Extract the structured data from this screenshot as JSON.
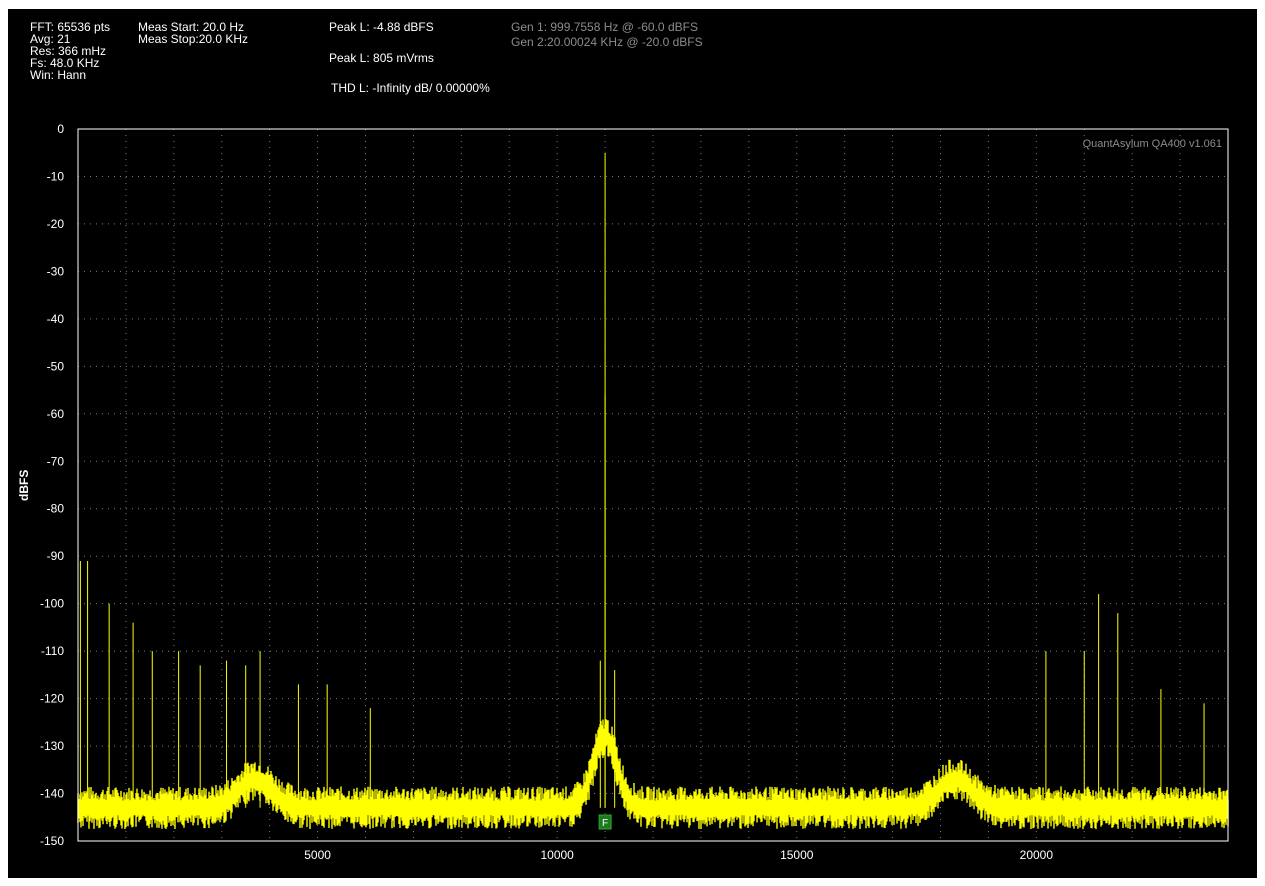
{
  "header": {
    "col1": [
      "FFT: 65536 pts",
      "Avg: 21",
      "Res: 366 mHz",
      "Fs: 48.0 KHz",
      "Win: Hann"
    ],
    "col2": [
      "Meas Start: 20.0 Hz",
      "Meas Stop:20.0 KHz"
    ],
    "peak_dbfs": "Peak L: -4.88 dBFS",
    "peak_vrms": "Peak L: 805 mVrms",
    "thd": "THD L: -Infinity dB/ 0.00000%",
    "gen1": "Gen 1: 999.7558 Hz @ -60.0  dBFS",
    "gen2": "Gen 2:20.00024 KHz @ -20.0  dBFS"
  },
  "watermark": "QuantAsylum QA400 v1.061",
  "marker_label": "F",
  "colors": {
    "background": "#000000",
    "trace": "#ffff00",
    "grid": "#7a7a7a",
    "text": "#ffffff",
    "gen_text": "#8c8c8c",
    "marker": "#1e7a1e"
  },
  "chart_data": {
    "type": "line",
    "title": "",
    "xlabel": "",
    "ylabel": "dBFS",
    "xlim": [
      0,
      24000
    ],
    "ylim": [
      -150,
      0
    ],
    "xticks": [
      5000,
      10000,
      15000,
      20000
    ],
    "yticks": [
      0,
      -10,
      -20,
      -30,
      -40,
      -50,
      -60,
      -70,
      -80,
      -90,
      -100,
      -110,
      -120,
      -130,
      -140,
      -150
    ],
    "grid": true,
    "noise_floor_dbfs": -143,
    "hump_regions": [
      {
        "x": 3700,
        "peak": -137
      },
      {
        "x": 11000,
        "peak": -128
      },
      {
        "x": 18300,
        "peak": -137
      }
    ],
    "peaks": [
      {
        "x": 11000,
        "y": -5
      },
      {
        "x": 11000,
        "y": -56
      },
      {
        "x": 50,
        "y": -91
      },
      {
        "x": 200,
        "y": -91
      },
      {
        "x": 650,
        "y": -100
      },
      {
        "x": 1150,
        "y": -104
      },
      {
        "x": 1550,
        "y": -110
      },
      {
        "x": 2100,
        "y": -110
      },
      {
        "x": 2550,
        "y": -113
      },
      {
        "x": 3100,
        "y": -112
      },
      {
        "x": 3500,
        "y": -113
      },
      {
        "x": 3800,
        "y": -110
      },
      {
        "x": 4600,
        "y": -117
      },
      {
        "x": 5200,
        "y": -117
      },
      {
        "x": 6100,
        "y": -122
      },
      {
        "x": 10900,
        "y": -112
      },
      {
        "x": 11200,
        "y": -114
      },
      {
        "x": 20200,
        "y": -110
      },
      {
        "x": 21000,
        "y": -110
      },
      {
        "x": 21300,
        "y": -98
      },
      {
        "x": 21700,
        "y": -102
      },
      {
        "x": 22600,
        "y": -118
      },
      {
        "x": 23500,
        "y": -121
      }
    ],
    "marker": {
      "x": 11000,
      "label": "F"
    }
  }
}
